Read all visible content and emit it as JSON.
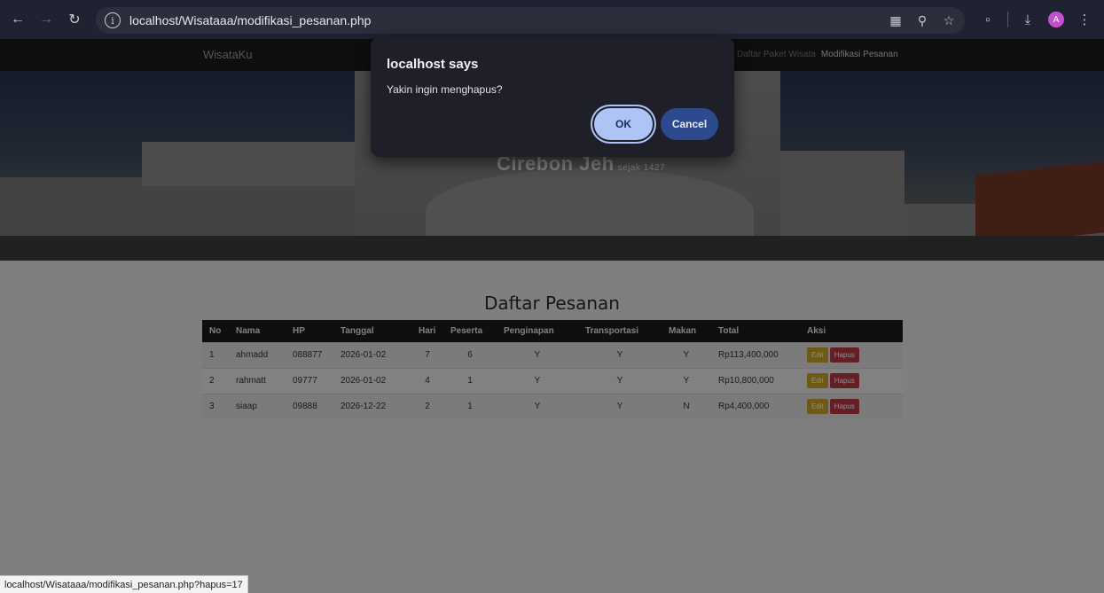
{
  "browser": {
    "url": "localhost/Wisataaa/modifikasi_pesanan.php",
    "avatar_letter": "A",
    "icons": [
      "back-icon",
      "forward-icon",
      "reload-icon",
      "site-info-icon",
      "translate-icon",
      "zoom-icon",
      "bookmark-star-icon",
      "extensions-icon",
      "download-icon",
      "profile-avatar",
      "menu-kebab-icon"
    ]
  },
  "site": {
    "brand": "WisataKu",
    "nav": {
      "paket": "Daftar Paket Wisata",
      "modifikasi": "Modifikasi Pesanan"
    },
    "hero_title": "Cirebon Jeh",
    "hero_subtitle": "sejak 1427"
  },
  "main": {
    "title": "Daftar Pesanan",
    "columns": [
      "No",
      "Nama",
      "HP",
      "Tanggal",
      "Hari",
      "Peserta",
      "Penginapan",
      "Transportasi",
      "Makan",
      "Total",
      "Aksi"
    ],
    "rows": [
      {
        "no": "1",
        "nama": "ahmadd",
        "hp": "088877",
        "tanggal": "2026-01-02",
        "hari": "7",
        "peserta": "6",
        "penginapan": "Y",
        "transportasi": "Y",
        "makan": "Y",
        "total": "Rp113,400,000"
      },
      {
        "no": "2",
        "nama": "rahmatt",
        "hp": "09777",
        "tanggal": "2026-01-02",
        "hari": "4",
        "peserta": "1",
        "penginapan": "Y",
        "transportasi": "Y",
        "makan": "Y",
        "total": "Rp10,800,000"
      },
      {
        "no": "3",
        "nama": "siaap",
        "hp": "09888",
        "tanggal": "2026-12-22",
        "hari": "2",
        "peserta": "1",
        "penginapan": "Y",
        "transportasi": "Y",
        "makan": "N",
        "total": "Rp4,400,000"
      }
    ],
    "edit_label": "Edit",
    "hapus_label": "Hapus"
  },
  "dialog": {
    "title": "localhost says",
    "message": "Yakin ingin menghapus?",
    "ok_label": "OK",
    "cancel_label": "Cancel"
  },
  "statusbar": {
    "text": "localhost/Wisataaa/modifikasi_pesanan.php?hapus=17"
  }
}
